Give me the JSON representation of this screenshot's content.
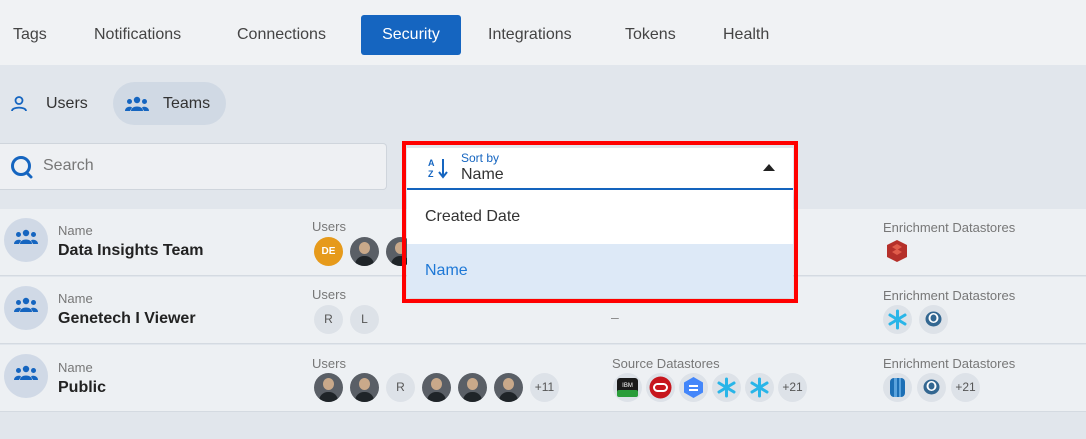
{
  "tabs": [
    {
      "label": "Tags"
    },
    {
      "label": "Notifications"
    },
    {
      "label": "Connections"
    },
    {
      "label": "Security",
      "active": true
    },
    {
      "label": "Integrations"
    },
    {
      "label": "Tokens"
    },
    {
      "label": "Health"
    }
  ],
  "subnav": {
    "users": "Users",
    "teams": "Teams",
    "active": "Teams"
  },
  "search": {
    "placeholder": "Search"
  },
  "sort": {
    "caption": "Sort by",
    "value": "Name",
    "options": [
      {
        "label": "Created Date"
      },
      {
        "label": "Name",
        "selected": true
      }
    ]
  },
  "teams": [
    {
      "name_label": "Name",
      "name": "Data Insights Team",
      "users_label": "Users",
      "users": [
        {
          "initials": "DE"
        },
        {
          "photo": true
        },
        {
          "photo": true
        }
      ],
      "enrichment_label": "Enrichment Datastores",
      "enrichment_icons": [
        "databricks-icon"
      ]
    },
    {
      "name_label": "Name",
      "name": "Genetech I Viewer",
      "users_label": "Users",
      "users": [
        {
          "initials": "R"
        },
        {
          "initials": "L"
        }
      ],
      "source_empty": "–",
      "enrichment_label": "Enrichment Datastores",
      "enrichment_icons": [
        "snowflake-icon",
        "postgresql-icon"
      ]
    },
    {
      "name_label": "Name",
      "name": "Public",
      "users_label": "Users",
      "users": [
        {
          "photo": true
        },
        {
          "photo": true
        },
        {
          "initials": "R"
        },
        {
          "photo": true
        },
        {
          "photo": true
        },
        {
          "photo": true
        }
      ],
      "users_more": "+11",
      "source_label": "Source Datastores",
      "source_icons": [
        "ibm-db2-icon",
        "oracle-icon",
        "bigquery-icon",
        "snowflake-icon",
        "snowflake-icon"
      ],
      "source_more": "+21",
      "enrichment_label": "Enrichment Datastores",
      "enrichment_icons": [
        "hive-icon",
        "postgresql-icon"
      ],
      "enrichment_more": "+21"
    }
  ],
  "colors": {
    "accent": "#1565c0",
    "highlight": "#ff0000",
    "selected_bg": "#dde9f7"
  }
}
